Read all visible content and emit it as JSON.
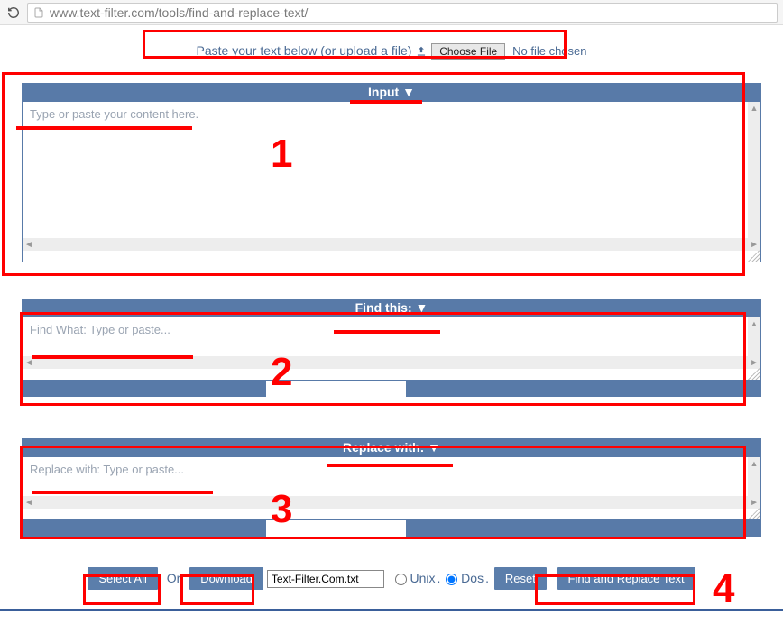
{
  "browser": {
    "url": "www.text-filter.com/tools/find-and-replace-text/"
  },
  "upload": {
    "prompt": "Paste your text below (or upload a file)",
    "choose_btn": "Choose File",
    "no_file": "No file chosen"
  },
  "sections": {
    "input": {
      "title": "Input ▼",
      "placeholder": "Type or paste your content here."
    },
    "find": {
      "title": "Find this: ▼",
      "placeholder": "Find What: Type or paste..."
    },
    "replace": {
      "title": "Replace with: ▼",
      "placeholder": "Replace with: Type or paste..."
    }
  },
  "controls": {
    "select_all": "Select All",
    "or": "Or",
    "download": "Download",
    "filename": "Text-Filter.Com.txt",
    "unix": "Unix",
    "dos": "Dos",
    "reset": "Reset",
    "submit": "Find and Replace Text"
  },
  "annotations": {
    "n1": "1",
    "n2": "2",
    "n3": "3",
    "n4": "4"
  }
}
